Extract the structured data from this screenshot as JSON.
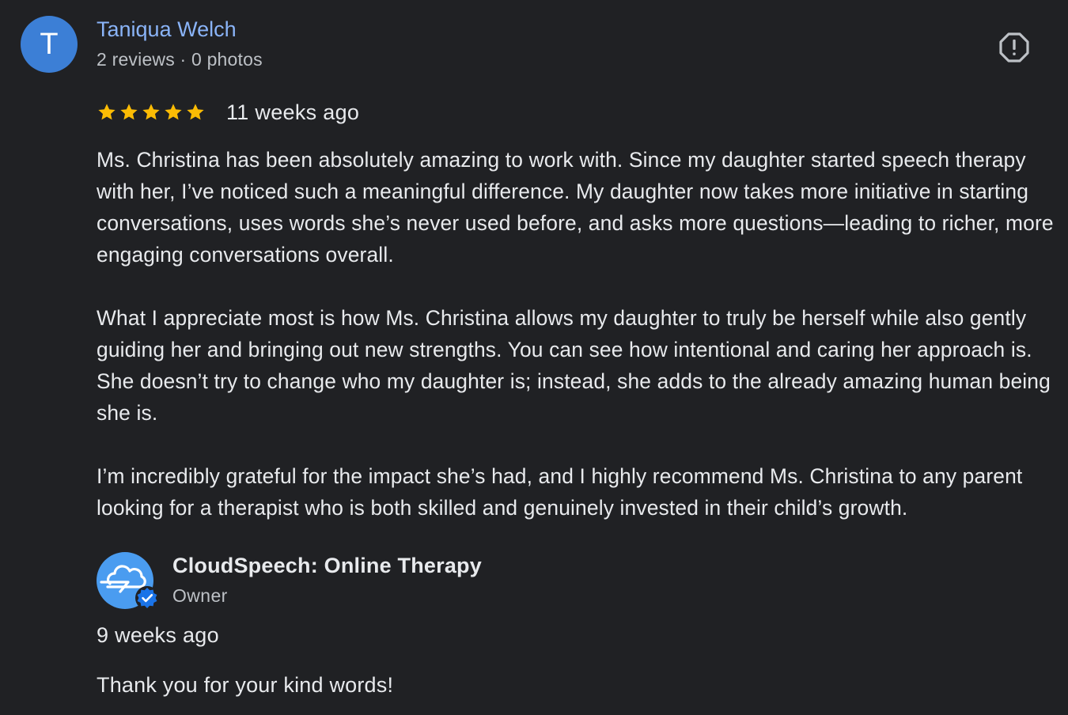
{
  "review": {
    "avatar_letter": "T",
    "reviewer_name": "Taniqua Welch",
    "reviewer_meta": "2 reviews · 0 photos",
    "rating": 5,
    "rating_max": 5,
    "time_ago": "11 weeks ago",
    "paragraphs": [
      "Ms. Christina has been absolutely amazing to work with. Since my daughter started speech therapy with her, I’ve noticed such a meaningful difference. My daughter now takes more initiative in starting conversations, uses words she’s never used before, and asks more questions—leading to richer, more engaging conversations overall.",
      "What I appreciate most is how Ms. Christina allows my daughter to truly be herself while also gently guiding her and bringing out new strengths. You can see how intentional and caring her approach is. She doesn’t try to change who my daughter is; instead, she adds to the already amazing human being she is.",
      "I’m incredibly grateful for the impact she’s had, and I highly recommend Ms. Christina to any parent looking for a therapist who is both skilled and genuinely invested in their child’s growth."
    ],
    "report_icon": "report-icon"
  },
  "owner_reply": {
    "name": "CloudSpeech: Online Therapy",
    "role": "Owner",
    "time_ago": "9 weeks ago",
    "text": "Thank you for your kind words!",
    "avatar_icon": "cloud-logo-icon",
    "badge_icon": "verified-badge-icon"
  },
  "colors": {
    "background": "#202124",
    "name_link": "#8ab4f8",
    "star": "#fbbc04",
    "avatar_bg": "#3c7fd6",
    "owner_avatar_bg": "#4a9cf0",
    "verified_badge": "#1a73e8"
  }
}
